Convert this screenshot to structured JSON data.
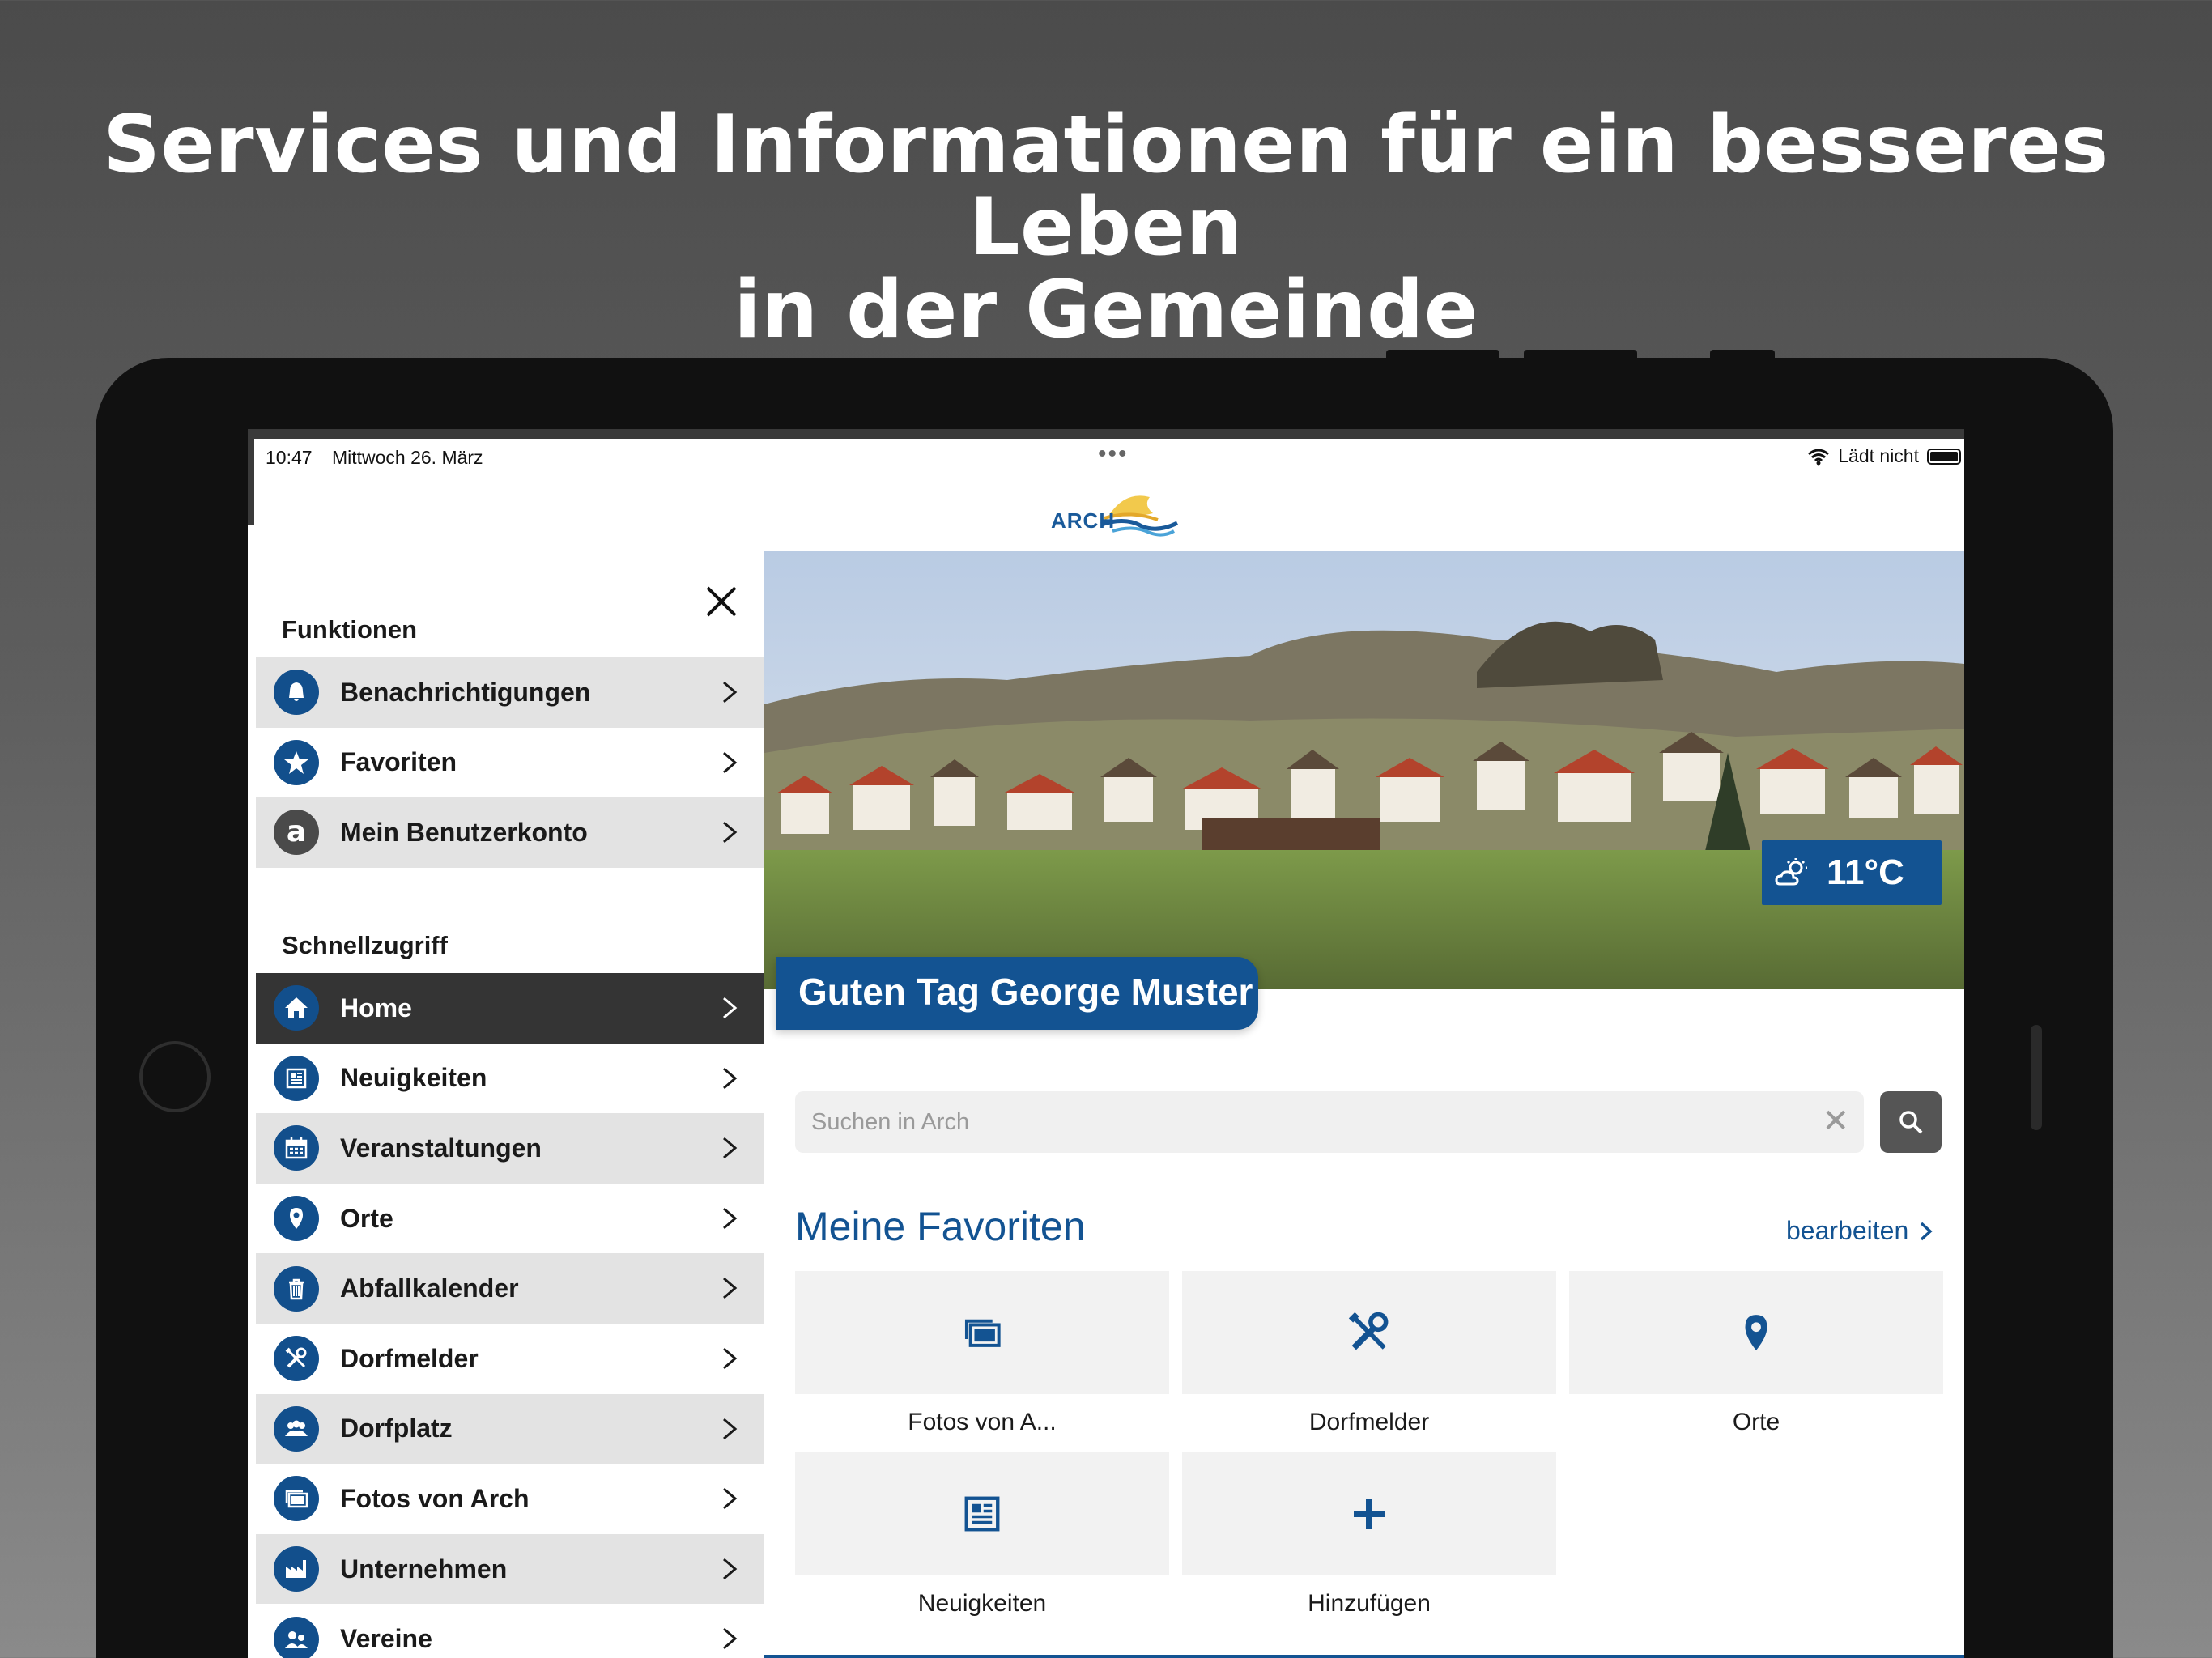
{
  "headline": {
    "line1": "Services und Informationen für ein besseres Leben",
    "line2": "in der Gemeinde"
  },
  "status_bar": {
    "time": "10:47",
    "date": "Mittwoch 26. März",
    "charging": "Lädt nicht"
  },
  "logo": {
    "text": "ARCH"
  },
  "sidebar": {
    "functions_title": "Funktionen",
    "functions": [
      {
        "label": "Benachrichtigungen",
        "icon": "bell-icon"
      },
      {
        "label": "Favoriten",
        "icon": "star-icon"
      },
      {
        "label": "Mein Benutzerkonto",
        "icon": "account-icon"
      }
    ],
    "quick_title": "Schnellzugriff",
    "quick": [
      {
        "label": "Home",
        "icon": "home-icon",
        "active": true
      },
      {
        "label": "Neuigkeiten",
        "icon": "newspaper-icon"
      },
      {
        "label": "Veranstaltungen",
        "icon": "calendar-icon"
      },
      {
        "label": "Orte",
        "icon": "location-pin-icon"
      },
      {
        "label": "Abfallkalender",
        "icon": "trash-icon"
      },
      {
        "label": "Dorfmelder",
        "icon": "tools-icon"
      },
      {
        "label": "Dorfplatz",
        "icon": "people-icon"
      },
      {
        "label": "Fotos von Arch",
        "icon": "photos-icon"
      },
      {
        "label": "Unternehmen",
        "icon": "factory-icon"
      },
      {
        "label": "Vereine",
        "icon": "club-icon"
      }
    ]
  },
  "hero": {
    "temperature": "11°C",
    "greeting": "Guten Tag George Muster"
  },
  "search": {
    "placeholder": "Suchen in Arch"
  },
  "favorites": {
    "title": "Meine Favoriten",
    "edit_label": "bearbeiten",
    "tiles": [
      {
        "label": "Fotos von A...",
        "icon": "photos-icon"
      },
      {
        "label": "Dorfmelder",
        "icon": "tools-icon"
      },
      {
        "label": "Orte",
        "icon": "location-pin-icon"
      },
      {
        "label": "Neuigkeiten",
        "icon": "newspaper-icon"
      },
      {
        "label": "Hinzufügen",
        "icon": "plus-icon"
      }
    ]
  },
  "colors": {
    "brand_blue": "#135392",
    "active_row": "#343434",
    "row_grey": "#e3e3e3"
  }
}
